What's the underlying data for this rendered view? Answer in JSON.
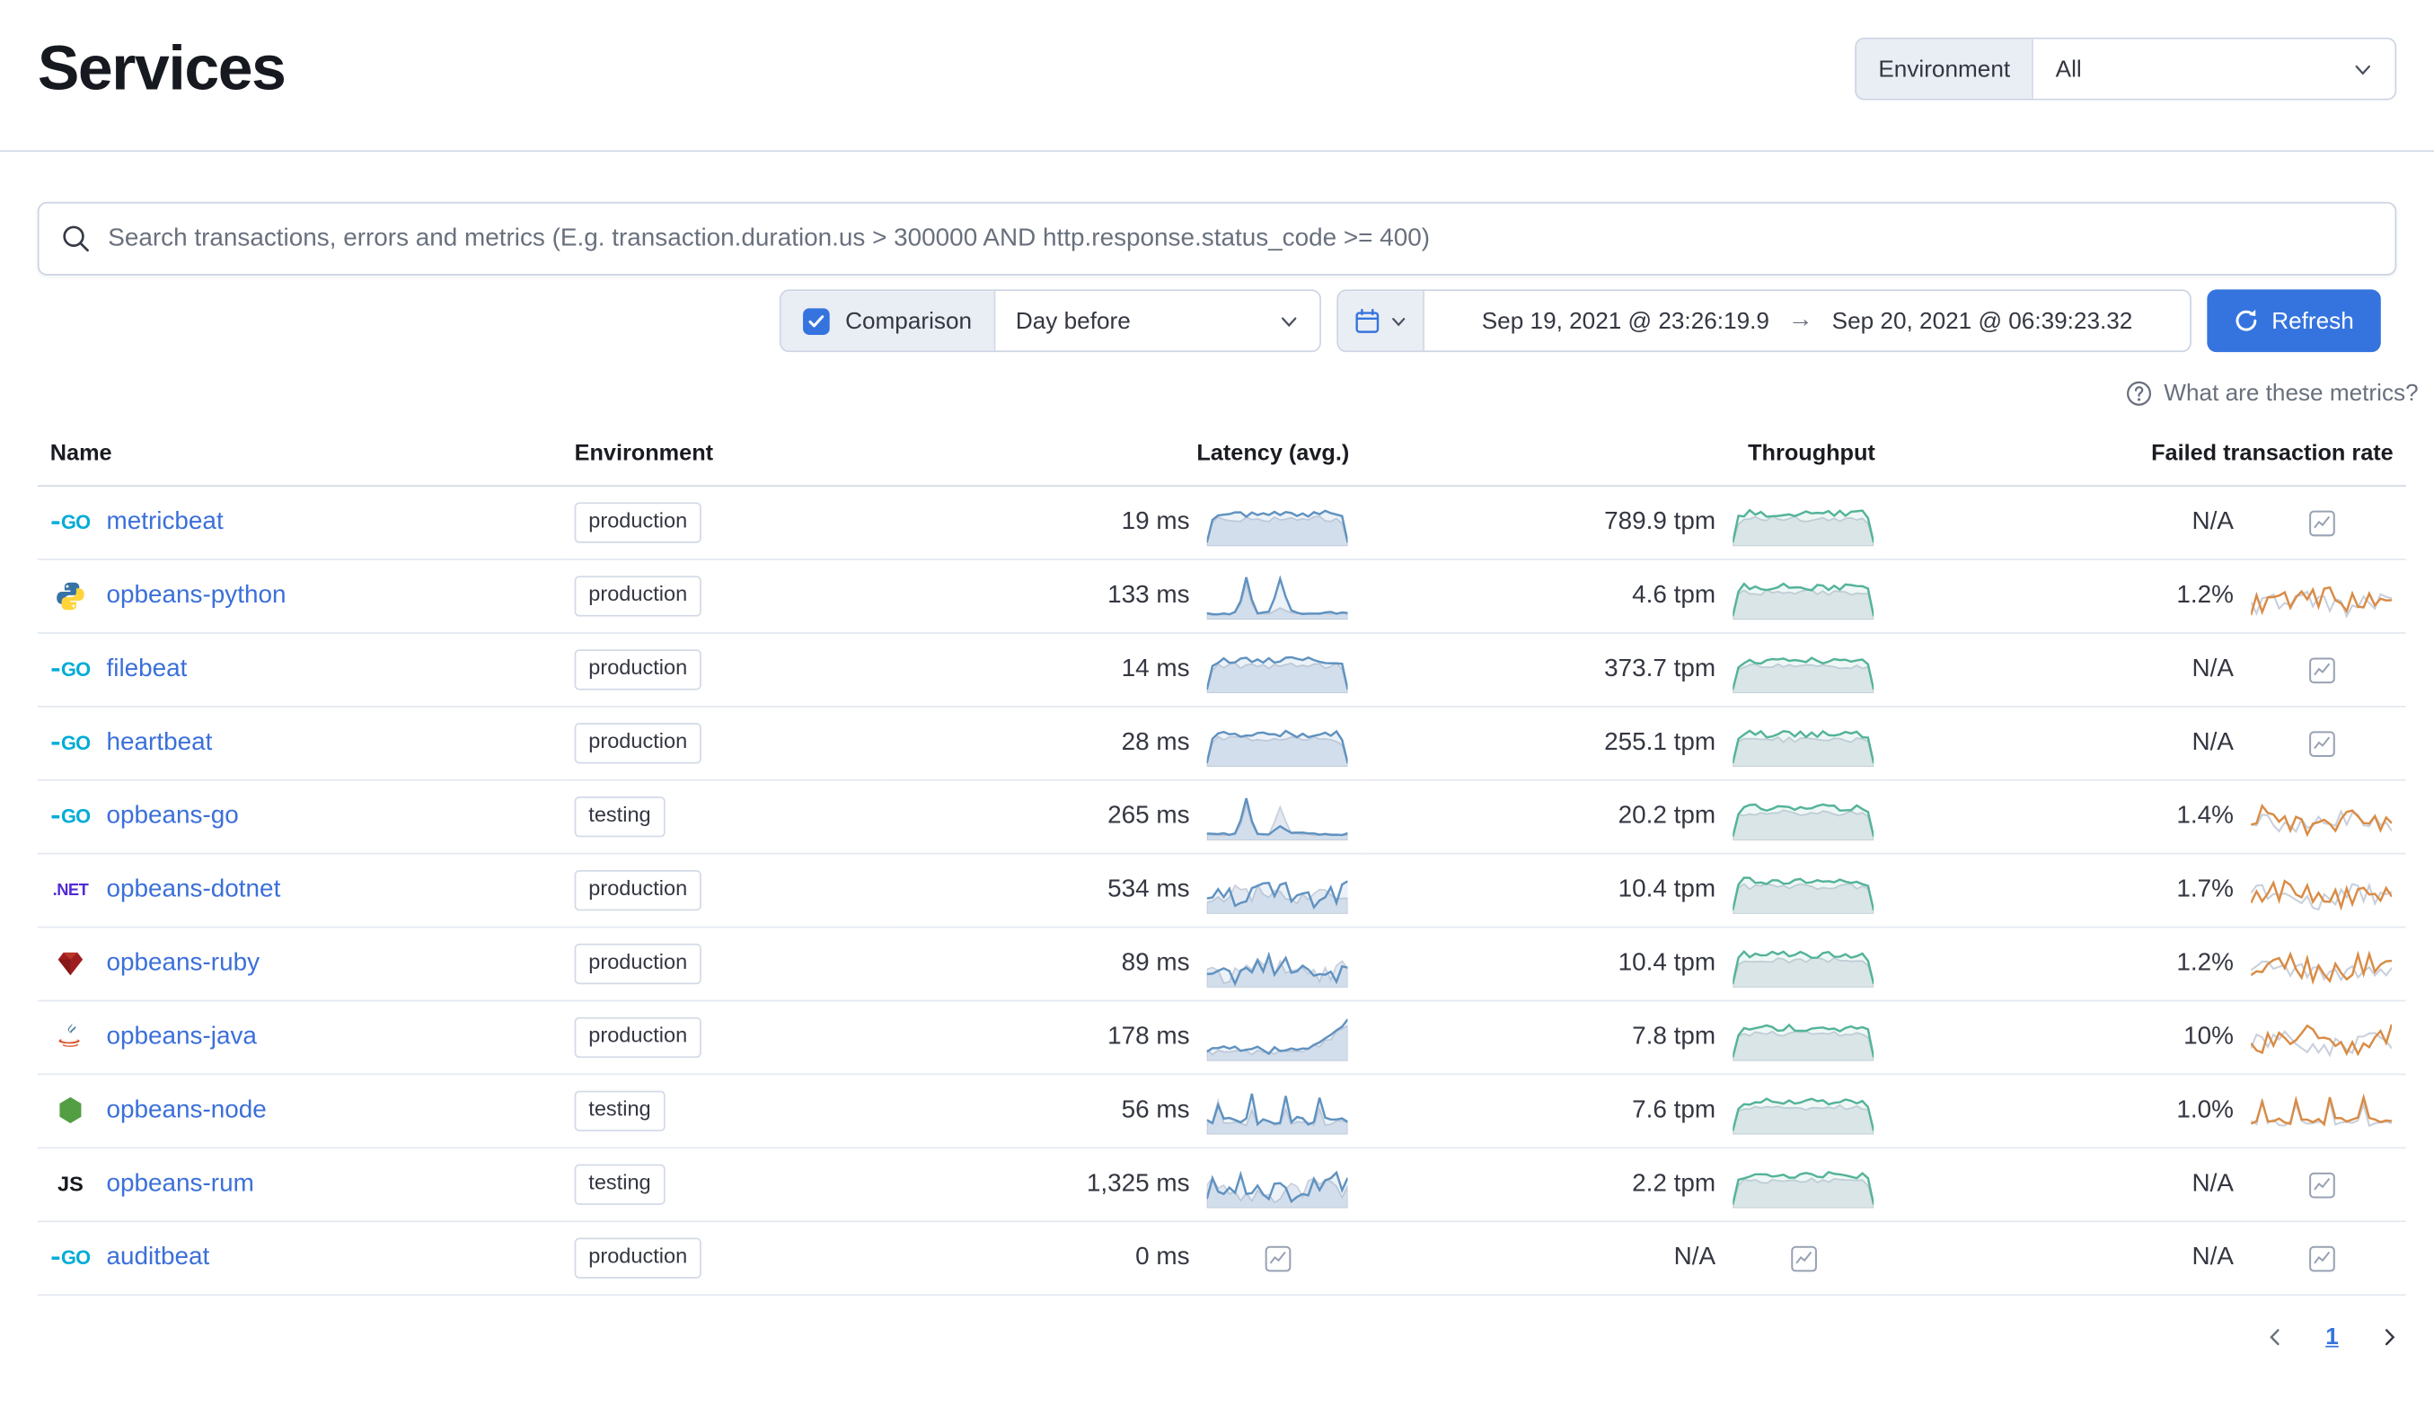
{
  "page": {
    "title": "Services"
  },
  "env_filter": {
    "label": "Environment",
    "value": "All"
  },
  "search": {
    "placeholder": "Search transactions, errors and metrics (E.g. transaction.duration.us > 300000 AND http.response.status_code >= 400)"
  },
  "controls": {
    "comparison_label": "Comparison",
    "comparison_checked": true,
    "comparison_value": "Day before",
    "date_start": "Sep 19, 2021 @ 23:26:19.9",
    "date_end": "Sep 20, 2021 @ 06:39:23.32",
    "refresh_label": "Refresh",
    "metrics_help_label": "What are these metrics?"
  },
  "icons": {
    "range_arrow": "→"
  },
  "agent_glyphs": {
    "go": "GO",
    "dotnet": ".NET",
    "js": "JS"
  },
  "table": {
    "columns": [
      "Name",
      "Environment",
      "Latency (avg.)",
      "Throughput",
      "Failed transaction rate"
    ],
    "rows": [
      {
        "name": "metricbeat",
        "agent": "go",
        "environment": "production",
        "latency": {
          "value": "19 ms",
          "trend": "plateau"
        },
        "throughput": {
          "value": "789.9 tpm",
          "trend": "plateau"
        },
        "failed": {
          "value": "N/A",
          "trend": "none"
        }
      },
      {
        "name": "opbeans-python",
        "agent": "python",
        "environment": "production",
        "latency": {
          "value": "133 ms",
          "trend": "spike"
        },
        "throughput": {
          "value": "4.6 tpm",
          "trend": "plateau"
        },
        "failed": {
          "value": "1.2%",
          "trend": "wiggle"
        }
      },
      {
        "name": "filebeat",
        "agent": "go",
        "environment": "production",
        "latency": {
          "value": "14 ms",
          "trend": "plateau"
        },
        "throughput": {
          "value": "373.7 tpm",
          "trend": "plateau"
        },
        "failed": {
          "value": "N/A",
          "trend": "none"
        }
      },
      {
        "name": "heartbeat",
        "agent": "go",
        "environment": "production",
        "latency": {
          "value": "28 ms",
          "trend": "plateau"
        },
        "throughput": {
          "value": "255.1 tpm",
          "trend": "plateau"
        },
        "failed": {
          "value": "N/A",
          "trend": "none"
        }
      },
      {
        "name": "opbeans-go",
        "agent": "go",
        "environment": "testing",
        "latency": {
          "value": "265 ms",
          "trend": "spike"
        },
        "throughput": {
          "value": "20.2 tpm",
          "trend": "plateau"
        },
        "failed": {
          "value": "1.4%",
          "trend": "wiggle"
        }
      },
      {
        "name": "opbeans-dotnet",
        "agent": "dotnet",
        "environment": "production",
        "latency": {
          "value": "534 ms",
          "trend": "wiggle"
        },
        "throughput": {
          "value": "10.4 tpm",
          "trend": "plateau"
        },
        "failed": {
          "value": "1.7%",
          "trend": "wiggle"
        }
      },
      {
        "name": "opbeans-ruby",
        "agent": "ruby",
        "environment": "production",
        "latency": {
          "value": "89 ms",
          "trend": "wiggle"
        },
        "throughput": {
          "value": "10.4 tpm",
          "trend": "plateau"
        },
        "failed": {
          "value": "1.2%",
          "trend": "wiggle"
        }
      },
      {
        "name": "opbeans-java",
        "agent": "java",
        "environment": "production",
        "latency": {
          "value": "178 ms",
          "trend": "rise"
        },
        "throughput": {
          "value": "7.8 tpm",
          "trend": "plateau"
        },
        "failed": {
          "value": "10%",
          "trend": "wiggle"
        }
      },
      {
        "name": "opbeans-node",
        "agent": "node",
        "environment": "testing",
        "latency": {
          "value": "56 ms",
          "trend": "spikes"
        },
        "throughput": {
          "value": "7.6 tpm",
          "trend": "plateau"
        },
        "failed": {
          "value": "1.0%",
          "trend": "spikes"
        }
      },
      {
        "name": "opbeans-rum",
        "agent": "js",
        "environment": "testing",
        "latency": {
          "value": "1,325 ms",
          "trend": "wiggle"
        },
        "throughput": {
          "value": "2.2 tpm",
          "trend": "plateau"
        },
        "failed": {
          "value": "N/A",
          "trend": "none"
        }
      },
      {
        "name": "auditbeat",
        "agent": "go",
        "environment": "production",
        "latency": {
          "value": "0 ms",
          "trend": "none"
        },
        "throughput": {
          "value": "N/A",
          "trend": "none"
        },
        "failed": {
          "value": "N/A",
          "trend": "none"
        }
      }
    ]
  },
  "pagination": {
    "current": "1"
  },
  "colors": {
    "accent": "#3574de",
    "link": "#3b6fd9",
    "latency_line": "#6092c0",
    "latency_fill": "rgba(96,146,192,0.12)",
    "latency_comp": "#e3e9f3",
    "throughput_line": "#54b399",
    "throughput_fill": "rgba(84,179,153,0.10)",
    "throughput_comp": "#e8ebef",
    "failed_line": "#d98b45",
    "comp_stroke": "#c9d0dc",
    "empty_icon": "#98a2b3",
    "go_brand": "#00acd7",
    "dotnet_brand": "#512bd4"
  }
}
